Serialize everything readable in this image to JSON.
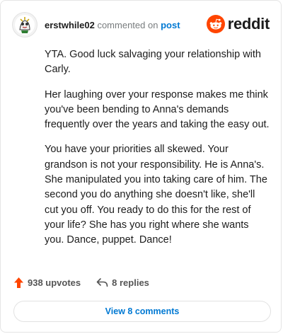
{
  "comment": {
    "username": "erstwhile02",
    "action_text": "commented on",
    "target_link": "post",
    "paragraphs": [
      "YTA. Good luck salvaging your relationship with Carly.",
      "Her laughing over your response makes me think you've been bending to Anna's demands frequently over the years and taking the easy out.",
      "You have your priorities all skewed. Your grandson is not your responsibility. He is Anna's. She manipulated you into taking care of him. The second you do anything she doesn't like, she'll cut you off. You ready to do this for the rest of your life? She has you right where she wants you. Dance, puppet. Dance!"
    ]
  },
  "brand": {
    "wordmark": "reddit",
    "icon": "reddit-snoo-icon",
    "color": "#ff4500"
  },
  "actions": {
    "upvotes": "938 upvotes",
    "replies": "8 replies",
    "upvote_icon": "upvote-arrow-icon",
    "reply_icon": "reply-arrow-icon"
  },
  "view_comments_label": "View 8 comments",
  "colors": {
    "accent": "#ff4500",
    "link": "#0079d3",
    "muted": "#787c7e"
  }
}
